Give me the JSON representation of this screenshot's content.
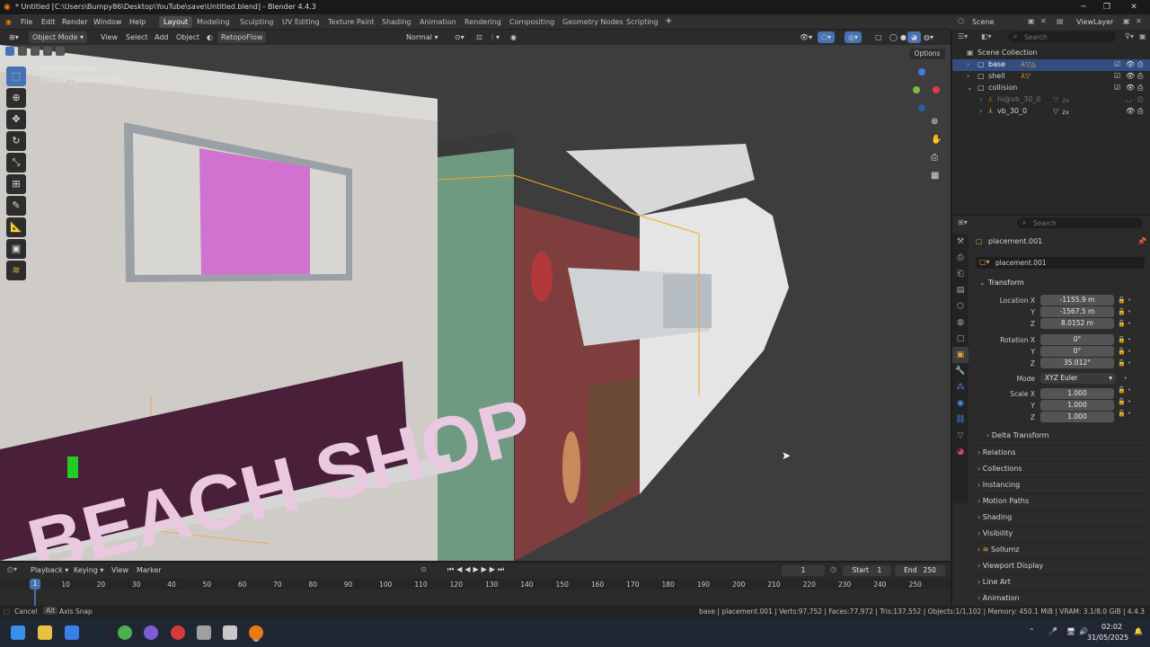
{
  "window": {
    "title": "* Untitled [C:\\Users\\Bumpy86\\Desktop\\YouTube\\save\\Untitled.blend] - Blender 4.4.3"
  },
  "menu": {
    "file": "File",
    "edit": "Edit",
    "render": "Render",
    "window": "Window",
    "help": "Help"
  },
  "workspaces": [
    "Layout",
    "Modeling",
    "Sculpting",
    "UV Editing",
    "Texture Paint",
    "Shading",
    "Animation",
    "Rendering",
    "Compositing",
    "Geometry Nodes",
    "Scripting"
  ],
  "scene": {
    "name": "Scene",
    "view_layer": "ViewLayer"
  },
  "header": {
    "mode": "Object Mode",
    "view": "View",
    "select": "Select",
    "add": "Add",
    "object": "Object",
    "addon": "RetopoFlow",
    "orientation": "Normal",
    "options": "Options"
  },
  "viewport": {
    "perspective": "User Perspective",
    "context": "(1) base | placement.001",
    "sign_text": "BEACH SHOP"
  },
  "outliner": {
    "search_placeholder": "Search",
    "root": "Scene Collection",
    "items": [
      {
        "name": "base"
      },
      {
        "name": "shell"
      },
      {
        "name": "collision"
      },
      {
        "name": "hi@vb_30_0"
      },
      {
        "name": "vb_30_0"
      }
    ],
    "badges": {
      "hi": "2x",
      "vb": "2x"
    }
  },
  "properties": {
    "search_placeholder": "Search",
    "object_name": "placement.001",
    "object_field": "placement.001",
    "transform_title": "Transform",
    "location_label": "Location X",
    "location": [
      "-1155.9 m",
      "-1567.5 m",
      "8.0152 m"
    ],
    "rotation_label": "Rotation X",
    "rotation": [
      "0°",
      "0°",
      "35.012°"
    ],
    "mode_label": "Mode",
    "mode": "XYZ Euler",
    "scale_label": "Scale X",
    "scale": [
      "1.000",
      "1.000",
      "1.000"
    ],
    "axis_y": "Y",
    "axis_z": "Z",
    "panels": [
      "Delta Transform",
      "Relations",
      "Collections",
      "Instancing",
      "Motion Paths",
      "Shading",
      "Visibility",
      "Sollumz",
      "Viewport Display",
      "Line Art",
      "Animation"
    ]
  },
  "timeline": {
    "playback": "Playback",
    "keying": "Keying",
    "view": "View",
    "marker": "Marker",
    "current_frame": "1",
    "start_label": "Start",
    "start": "1",
    "end_label": "End",
    "end": "250",
    "ruler": [
      "1",
      "10",
      "20",
      "30",
      "40",
      "50",
      "60",
      "70",
      "80",
      "90",
      "100",
      "110",
      "120",
      "130",
      "140",
      "150",
      "160",
      "170",
      "180",
      "190",
      "200",
      "210",
      "220",
      "230",
      "240",
      "250"
    ]
  },
  "statusbar": {
    "cancel": "Cancel",
    "alt": "Alt",
    "axis_snap": "Axis Snap",
    "stats": "base | placement.001 | Verts:97,752 | Faces:77,972 | Tris:137,552 | Objects:1/1,102 | Memory: 450.1 MiB | VRAM: 3.1/8.0 GiB | 4.4.3"
  },
  "taskbar": {
    "time": "02:02",
    "date": "31/05/2025"
  },
  "colors": {
    "accent": "#4772b3",
    "selected": "#f5a623",
    "sign_bg": "#4a1f3a",
    "sign_text": "#e9c8e0",
    "magenta": "#d26cd0"
  }
}
